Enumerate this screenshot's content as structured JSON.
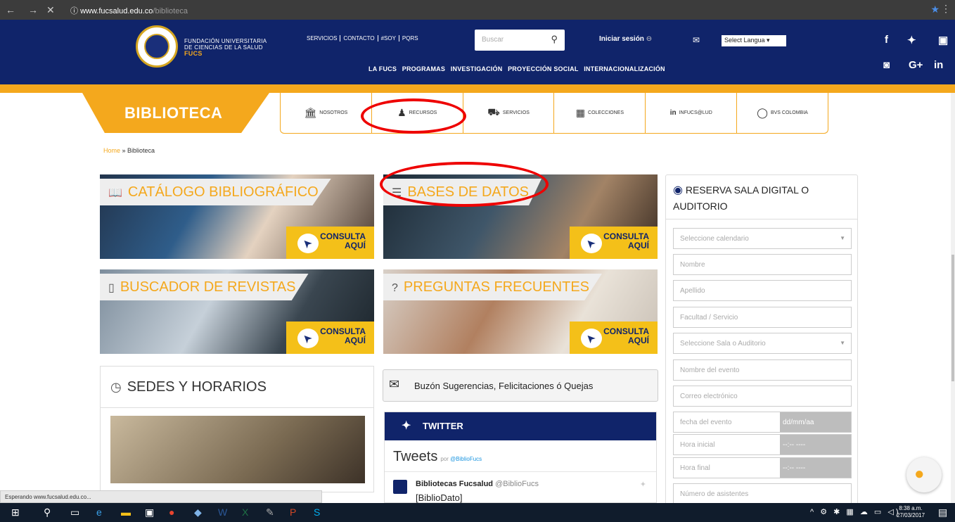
{
  "browser": {
    "back": "←",
    "forward": "→",
    "stop": "✕",
    "info": "ⓘ",
    "url_host": "www.fucsalud.edu.co",
    "url_path": "/biblioteca",
    "star": "★",
    "menu": "⋮"
  },
  "header": {
    "logo_line1": "FUNDACIÓN UNIVERSITARIA",
    "logo_line2": "DE CIENCIAS DE LA SALUD",
    "logo_line3": "FUCS",
    "top_links": [
      "SERVICIOS",
      "CONTACTO",
      "#SOY",
      "PQRS"
    ],
    "search_placeholder": "Buscar",
    "search_icon": "magnifier-icon",
    "login": "Iniciar sesión",
    "login_icon": "⊖",
    "mail": "✉",
    "language": "Select Langua ▾",
    "main_nav": [
      "LA FUCS",
      "PROGRAMAS",
      "INVESTIGACIÓN",
      "PROYECCIÓN SOCIAL",
      "INTERNACIONALIZACIÓN"
    ],
    "social": {
      "facebook": "f",
      "twitter": "🐦",
      "youtube": "▣",
      "instagram": "◙",
      "googleplus": "G+",
      "linkedin": "in"
    }
  },
  "bib_tab": "BIBLIOTECA",
  "subnav": [
    {
      "icon": "🏛",
      "label": "NOSOTROS"
    },
    {
      "icon": "♟",
      "label": "RECURSOS"
    },
    {
      "icon": "⛟",
      "label": "SERVICIOS"
    },
    {
      "icon": "▦",
      "label": "COLECCIONES"
    },
    {
      "icon": "in",
      "label": "INFUCS@LUD"
    },
    {
      "icon": "◯",
      "label": "BVS COLOMBIA"
    }
  ],
  "breadcrumb": {
    "home": "Home",
    "sep": " » ",
    "current": "Biblioteca"
  },
  "banners": [
    {
      "icon": "📖",
      "label": "CATÁLOGO BIBLIOGRÁFICO",
      "btn1": "CONSULTA",
      "btn2": "AQUÍ"
    },
    {
      "icon": "☰",
      "label": "BASES DE DATOS",
      "btn1": "CONSULTA",
      "btn2": "AQUÍ"
    },
    {
      "icon": "▯",
      "label": "BUSCADOR DE REVISTAS",
      "btn1": "CONSULTA",
      "btn2": "AQUÍ"
    },
    {
      "icon": "?",
      "label": "PREGUNTAS FRECUENTES",
      "btn1": "CONSULTA",
      "btn2": "AQUÍ"
    }
  ],
  "sedes": {
    "icon": "◷",
    "title": "SEDES Y HORARIOS"
  },
  "buzon": {
    "icon": "✉",
    "text": "Buzón Sugerencias, Felicitaciones ó Quejas"
  },
  "twitter": {
    "title": "TWITTER",
    "tweets": "Tweets",
    "by_prefix": "por",
    "by_handle": "@BiblioFucs",
    "account_name": "Bibliotecas Fucsalud",
    "account_handle": "@BiblioFucs",
    "message": "[BiblioDato]"
  },
  "reserva": {
    "title": "RESERVA SALA DIGITAL O AUDITORIO",
    "fields": {
      "calendario": "Seleccione calendario",
      "nombre": "Nombre",
      "apellido": "Apellido",
      "facultad": "Facultad / Servicio",
      "sala": "Seleccione Sala o Auditorio",
      "evento": "Nombre del evento",
      "correo": "Correo electrónico",
      "fecha": "fecha del evento",
      "fecha_value": "dd/mm/aa",
      "hora_inicial": "Hora inicial",
      "hora_inicial_value": "--:-- ----",
      "hora_final": "Hora final",
      "hora_final_value": "--:-- ----",
      "asistentes": "Número de asistentes"
    }
  },
  "status_bar": "Esperando www.fucsalud.edu.co...",
  "taskbar": {
    "time": "8:38 a.m.",
    "date": "27/03/2017",
    "tray": "^ ⚙ ✱ ▦ ☁ ▭ ◁)"
  }
}
